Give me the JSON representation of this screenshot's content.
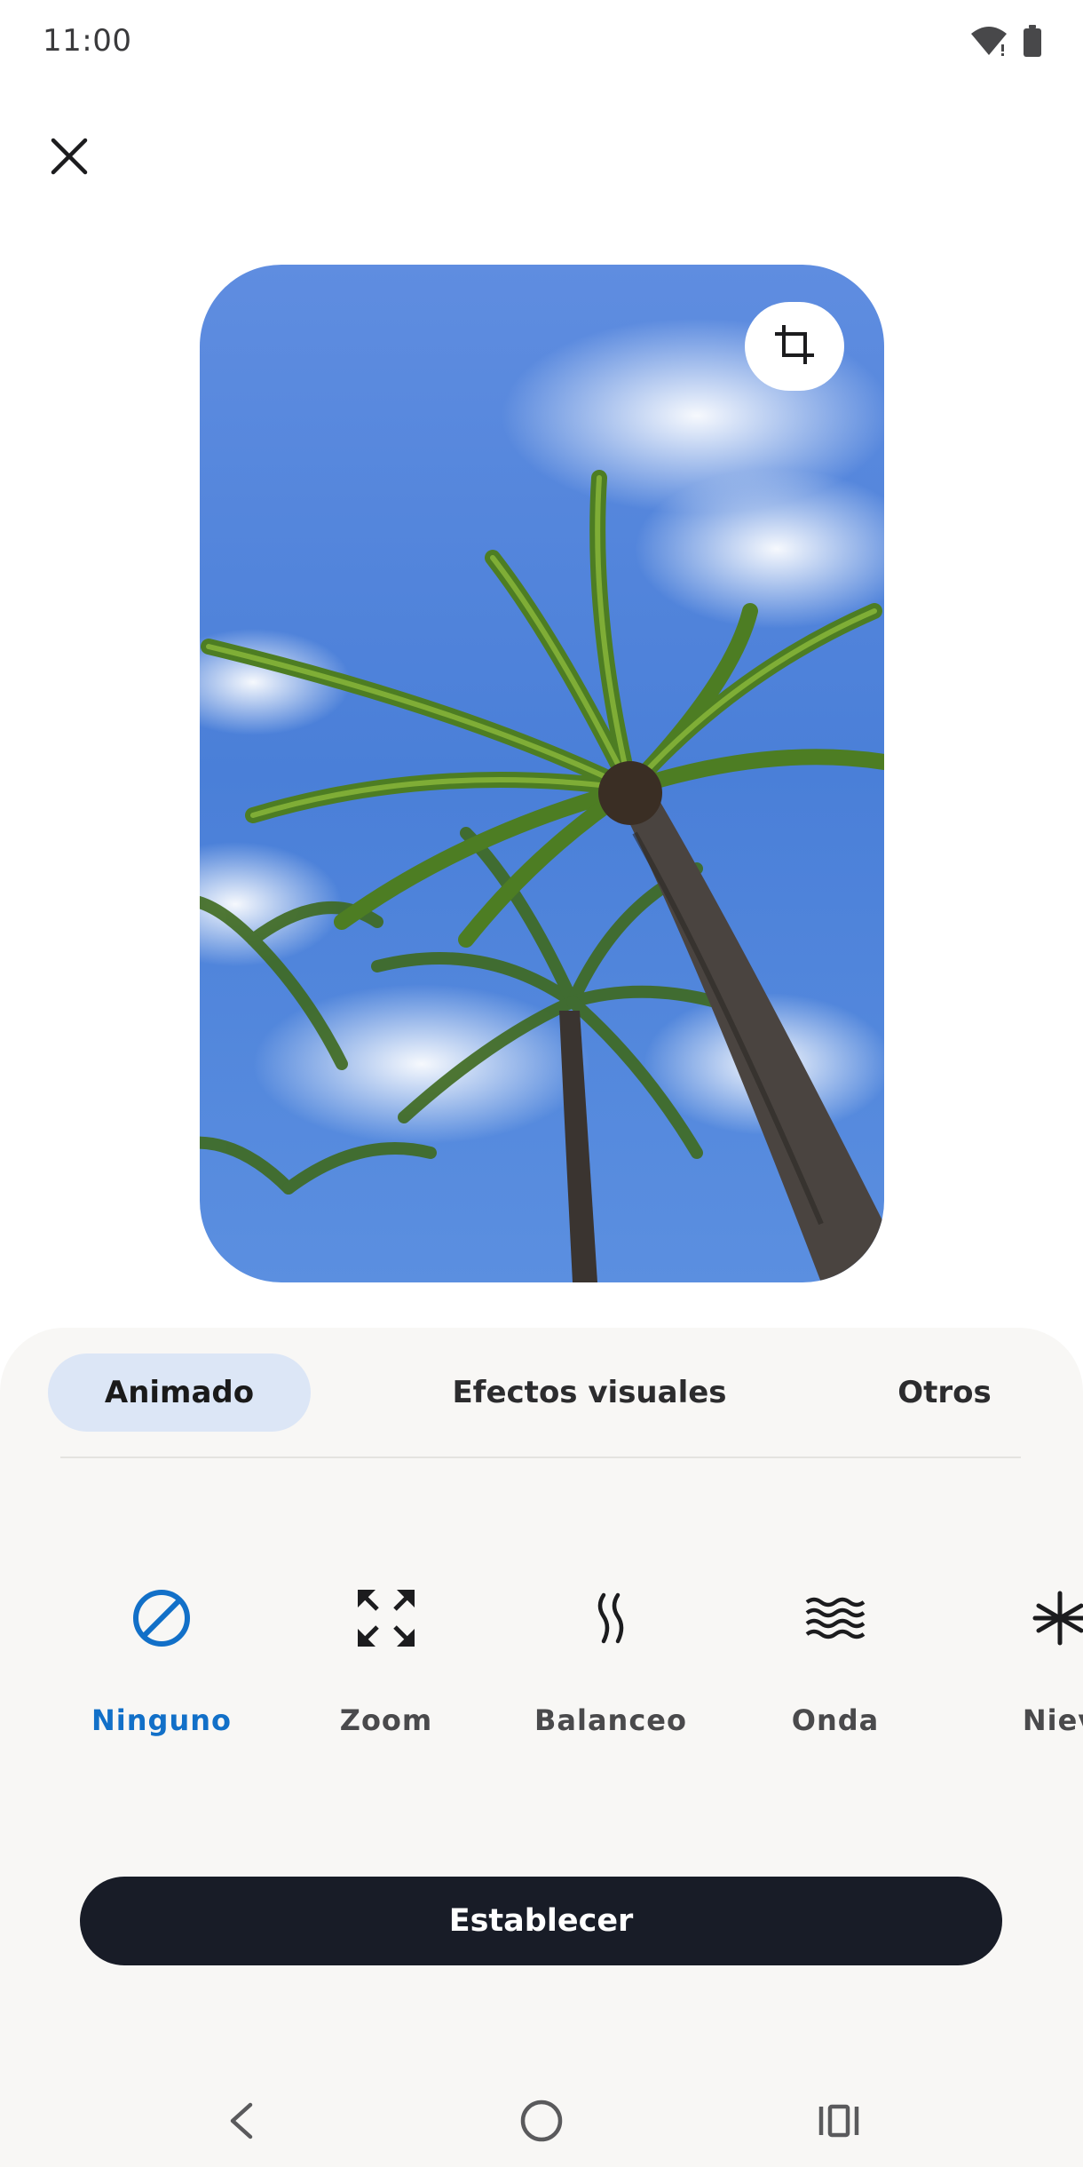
{
  "status_bar": {
    "time": "11:00",
    "icons": [
      "wifi-icon",
      "battery-icon"
    ]
  },
  "header": {
    "close_icon": "close-icon"
  },
  "preview": {
    "crop_icon": "crop-icon"
  },
  "tabs": [
    {
      "label": "Animado",
      "active": true
    },
    {
      "label": "Efectos visuales",
      "active": false
    },
    {
      "label": "Otros",
      "active": false
    }
  ],
  "effects": [
    {
      "label": "Ninguno",
      "icon": "none-icon",
      "selected": true
    },
    {
      "label": "Zoom",
      "icon": "zoom-icon",
      "selected": false
    },
    {
      "label": "Balanceo",
      "icon": "sway-icon",
      "selected": false
    },
    {
      "label": "Onda",
      "icon": "wave-icon",
      "selected": false
    },
    {
      "label": "Niev",
      "icon": "snow-icon",
      "selected": false
    }
  ],
  "primary_button": {
    "label": "Establecer"
  },
  "navigation": [
    "back-icon",
    "home-icon",
    "recents-icon"
  ],
  "colors": {
    "accent": "#1270c8",
    "button": "#181c27",
    "tab_active": "#dce6f6",
    "sheet": "#f8f7f5"
  }
}
